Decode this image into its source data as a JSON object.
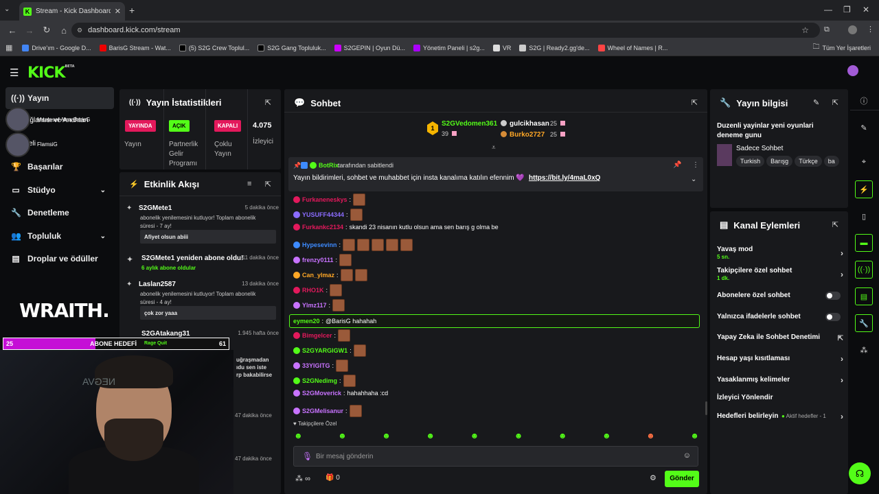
{
  "browser": {
    "tab_title": "Stream - Kick Dashboard",
    "tab_favicon": "K",
    "url": "dashboard.kick.com/stream",
    "bookmarks": [
      "Drive'ım - Google D...",
      "BarisG Stream - Wat...",
      "(5) S2G Crew Toplul...",
      "S2G Gang Topluluk...",
      "S2GEPIN | Oyun Dü...",
      "Yönetim Paneli | s2g...",
      "VR",
      "S2G | Ready2.gg'de...",
      "Wheel of Names | R..."
    ],
    "bookmarks_right": "Tüm Yer İşaretleri"
  },
  "brand": {
    "logo": "KICK",
    "beta": "BETA",
    "accent": "#53fc18"
  },
  "sidebar": {
    "items": [
      {
        "label": "Yayın",
        "icon": "broadcast-icon"
      },
      {
        "label": "Başarılar",
        "icon": "trophy-icon"
      },
      {
        "label": "Stüdyo",
        "icon": "studio-icon"
      },
      {
        "label": "Denetleme",
        "icon": "wrench-icon"
      },
      {
        "label": "Topluluk",
        "icon": "people-icon"
      },
      {
        "label": "Droplar ve ödüller",
        "icon": "drops-icon"
      }
    ],
    "overlay_text_1": "Maalesef Ama BarisG",
    "overlay_text_2": "ın Bağlantısı ve Anahtarı",
    "overlay_text_3": "eli",
    "overlay_text_4": "FlamsiG",
    "sponsor": "WRAITH."
  },
  "goal_bar": {
    "left": "25",
    "label": "ABONE HEDEFİ",
    "right": "61",
    "sub": "Rage Quit",
    "progress": 0.41
  },
  "stats": {
    "title": "Yayın İstatistikleri",
    "cols": [
      {
        "badge": "YAYINDA",
        "label": "Yayın"
      },
      {
        "badge": "AÇIK",
        "label": "Partnerlik Gelir Programı"
      },
      {
        "badge": "KAPALI",
        "label": "Çoklu Yayın"
      },
      {
        "badge": "4.075",
        "label": "İzleyici"
      }
    ]
  },
  "activity": {
    "title": "Etkinlik Akışı",
    "items": [
      {
        "name": "S2GMete1",
        "time": "5 dakika önce",
        "desc": "abonelik yenilemesini kutluyor! Toplam abonelik süresi - 7 ay!",
        "msg": "Afiyet olsun abiii"
      },
      {
        "name": "S2GMete1 yeniden abone oldu!",
        "time": "11 dakika önce",
        "desc": "6 aylık abone oldular"
      },
      {
        "name": "Laslan2587",
        "time": "13 dakika önce",
        "desc": "abonelik yenilemesini kutluyor! Toplam abonelik süresi - 4 ay!",
        "msg": "çok zor yaaa"
      },
      {
        "name": "S2GAtakang31",
        "time": "1.945 hafta önce"
      },
      {
        "time": "47 dakika önce"
      },
      {
        "time": "47 dakika önce"
      }
    ],
    "fragment_1": "uğraşmadan",
    "fragment_2": "ıdu sen iste",
    "fragment_3": "rp bakabilirse"
  },
  "chat": {
    "title": "Sohbet",
    "top_gifters": [
      {
        "rank": "1",
        "name": "S2GVedomen361",
        "count": "39"
      },
      {
        "name": "gulcikhasan",
        "count": "25"
      },
      {
        "name": "Burko2727",
        "count": "25"
      }
    ],
    "pinned": {
      "by": "BotRix",
      "by_suffix": "tarafından sabitlendi",
      "text": "Yayın bildirimleri, sohbet ve muhabbet için insta kanalıma katılın efennim 💜",
      "link": "https://bit.ly/4maL0xQ"
    },
    "messages": [
      {
        "user": "Furkaneneskys",
        "color": "#e3195c",
        "text": "",
        "emotes": 1
      },
      {
        "user": "YUSUFF44344",
        "color": "#8b6cff",
        "text": "",
        "emotes": 1
      },
      {
        "user": "Furkankc2134",
        "color": "#e3195c",
        "text": "skandi 23 nisanın kutlu olsun ama sen barış g olma be",
        "emotes": 0
      },
      {
        "user": "Hypesevinn",
        "color": "#3d8bff",
        "text": "",
        "emotes": 5
      },
      {
        "user": "frenzy0111",
        "color": "#c873ff",
        "text": "",
        "emotes": 1
      },
      {
        "user": "Can_ylmaz",
        "color": "#ffa726",
        "text": "",
        "emotes": 2
      },
      {
        "user": "RHO1K",
        "color": "#e3195c",
        "text": "",
        "emotes": 1
      },
      {
        "user": "Ylmz117",
        "color": "#c873ff",
        "text": "",
        "emotes": 1
      },
      {
        "user": "eymen20",
        "color": "#53fc18",
        "text": "@BarisG hahahah",
        "emotes": 0,
        "highlight": true
      },
      {
        "user": "Bimgelcer",
        "color": "#e3195c",
        "text": "",
        "emotes": 1
      },
      {
        "user": "S2GYARGIGW1",
        "color": "#53fc18",
        "text": "",
        "emotes": 1
      },
      {
        "user": "33YIGITG",
        "color": "#c873ff",
        "text": "",
        "emotes": 1
      },
      {
        "user": "S2GNedimg",
        "color": "#53fc18",
        "text": "",
        "emotes": 1
      },
      {
        "user": "S2GMoverick",
        "color": "#c873ff",
        "text": "hahahhaha :cd",
        "emotes": 0
      },
      {
        "user": "S2GMelisanur",
        "color": "#c873ff",
        "text": "",
        "emotes": 1
      }
    ],
    "followers_only": "Takipçilere Özel",
    "placeholder": "Bir mesaj gönderin",
    "points": "∞",
    "count": "0",
    "send": "Gönder"
  },
  "stream_info": {
    "title": "Yayın bilgisi",
    "stream_title": "Duzenli yayinlar yeni oyunlari deneme gunu",
    "category": "Sadece Sohbet",
    "tags": [
      "Turkish",
      "Barışg",
      "Türkçe",
      "ba"
    ]
  },
  "channel_actions": {
    "title": "Kanal Eylemleri",
    "items": [
      {
        "label": "Yavaş mod",
        "sub": "5 sn.",
        "type": "arrow"
      },
      {
        "label": "Takipçilere özel sohbet",
        "sub": "1 dk.",
        "type": "arrow"
      },
      {
        "label": "Abonelere özel sohbet",
        "type": "toggle"
      },
      {
        "label": "Yalnızca ifadelerle sohbet",
        "type": "toggle"
      },
      {
        "label": "Yapay Zeka ile Sohbet Denetimi",
        "type": "external"
      },
      {
        "label": "Hesap yaşı kısıtlaması",
        "type": "arrow"
      },
      {
        "label": "Yasaklanmış kelimeler",
        "type": "arrow"
      },
      {
        "label": "İzleyici Yönlendir",
        "type": "none"
      },
      {
        "label": "Hedefleri belirleyin",
        "sub": "Aktif hedefler - 1",
        "type": "arrow"
      }
    ]
  }
}
